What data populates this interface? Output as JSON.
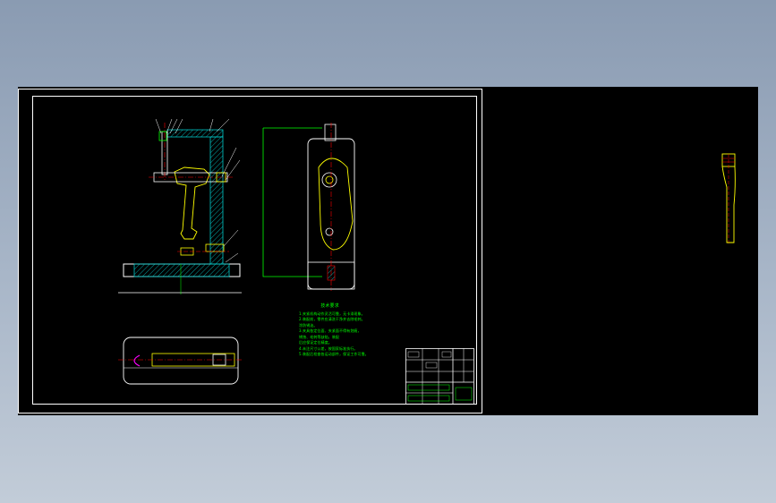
{
  "drawing": {
    "notes": {
      "title": "技术要求",
      "lines": [
        "1.夹紧机构动作灵活可靠，无卡滞现象。",
        "2.装配前，零件应清洗干净并去除毛刺。",
        "   涂防锈油。",
        "3.夹具各定位面、夹紧面不得有划痕，",
        "   锈蚀、毛刺等缺陷，装配",
        "   后应保证定位精度。",
        "4.未注尺寸公差，按国家标准执行。",
        "5.装配后检查各运动部件，保证工作可靠。"
      ]
    }
  },
  "colors": {
    "background_top": "#8a9bb2",
    "canvas": "#000000",
    "frame": "#ffffff",
    "part_outline": "#ffff00",
    "center_line": "#ff0000",
    "hatch": "#00c8c8",
    "dimension": "#00ff00"
  }
}
